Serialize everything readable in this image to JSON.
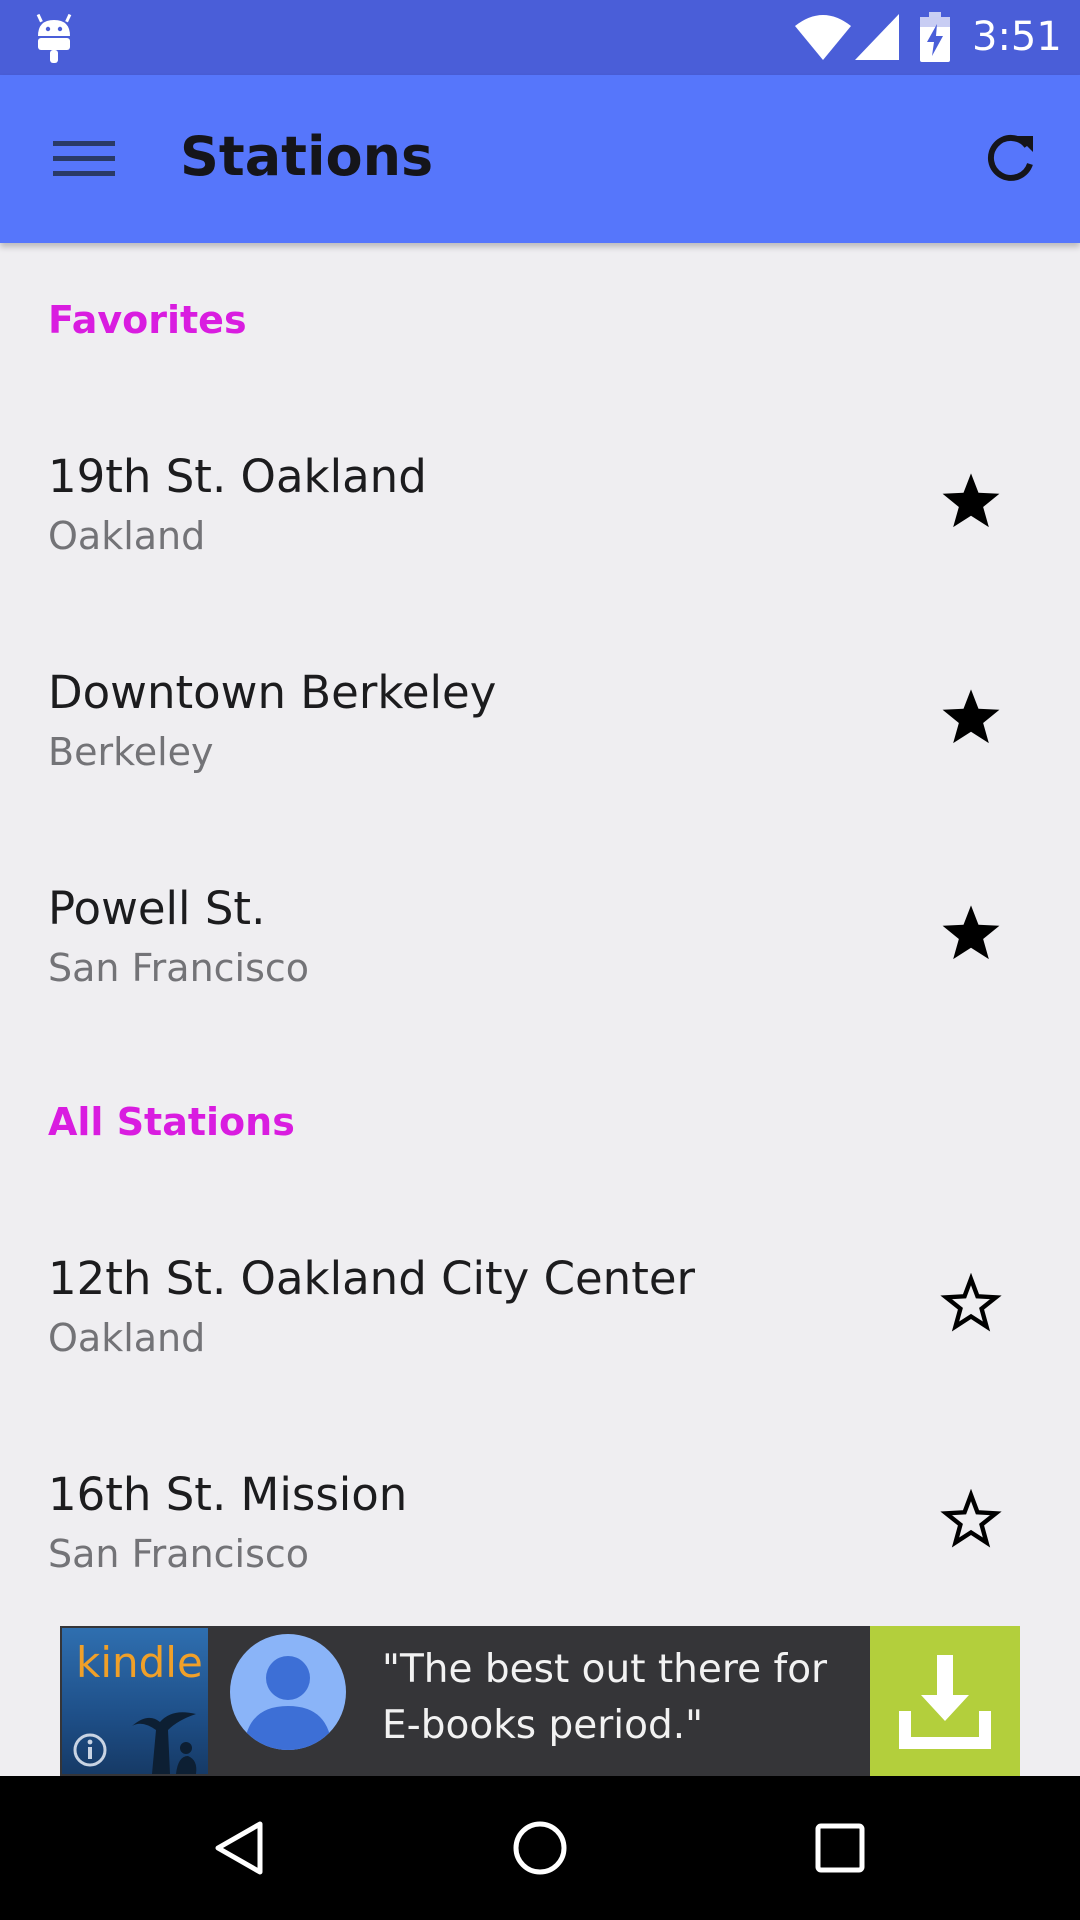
{
  "status_bar": {
    "time": "3:51",
    "icons": [
      "android-icon",
      "wifi-icon",
      "signal-icon",
      "battery-charging-icon"
    ]
  },
  "app_bar": {
    "title": "Stations",
    "menu_icon": "hamburger-menu-icon",
    "refresh_icon": "refresh-icon"
  },
  "favorites": {
    "header": "Favorites",
    "items": [
      {
        "name": "19th St. Oakland",
        "city": "Oakland",
        "starred": true
      },
      {
        "name": "Downtown Berkeley",
        "city": "Berkeley",
        "starred": true
      },
      {
        "name": "Powell St.",
        "city": "San Francisco",
        "starred": true
      }
    ]
  },
  "all_stations": {
    "header": "All Stations",
    "items": [
      {
        "name": "12th St. Oakland City Center",
        "city": "Oakland",
        "starred": false
      },
      {
        "name": "16th St. Mission",
        "city": "San Francisco",
        "starred": false
      }
    ]
  },
  "ad": {
    "brand": "kindle",
    "text": "\"The best out there for E-books period.\"",
    "download_icon": "download-icon",
    "info_icon": "info-icon"
  },
  "nav_bar": {
    "icons": [
      "back-icon",
      "home-icon",
      "recents-icon"
    ]
  },
  "colors": {
    "status_bar": "#4a5ed8",
    "app_bar": "#5676fb",
    "section_header": "#d91ce0",
    "background": "#efeef1",
    "ad_download": "#b3cf3c"
  }
}
